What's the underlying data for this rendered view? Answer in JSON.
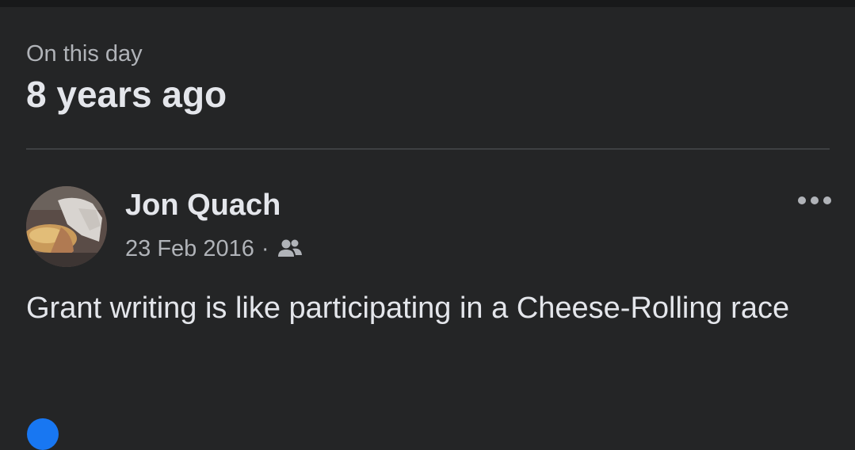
{
  "memory": {
    "eyebrow": "On this day",
    "title": "8 years ago"
  },
  "post": {
    "author": "Jon Quach",
    "date": "23 Feb 2016",
    "separator": "·",
    "audience_icon": "friends-icon",
    "more_icon": "more-options-icon",
    "text": "Grant writing is like participating in a Cheese-Rolling race"
  },
  "colors": {
    "background": "#242526",
    "primary_text": "#e4e6eb",
    "secondary_text": "#b0b3b8",
    "divider": "#3e4042",
    "accent": "#1877f2"
  }
}
